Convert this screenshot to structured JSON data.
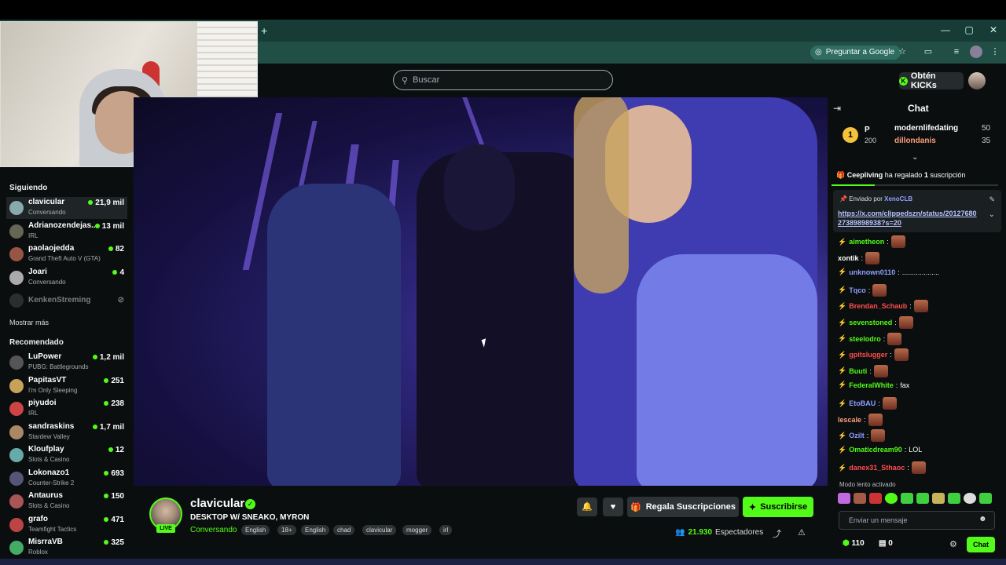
{
  "browser": {
    "new_tab": "+",
    "ask_google": "Preguntar a Google",
    "win_min": "—",
    "win_max": "▢",
    "win_close": "✕"
  },
  "site": {
    "search_placeholder": "Buscar",
    "get_kicks": "Obtén KICKs"
  },
  "sidebar": {
    "following_title": "Siguiendo",
    "following": [
      {
        "name": "clavicular",
        "category": "Conversando",
        "viewers": "21,9 mil"
      },
      {
        "name": "Adrianozendejas...",
        "category": "IRL",
        "viewers": "13 mil"
      },
      {
        "name": "paolaojedda",
        "category": "Grand Theft Auto V (GTA)",
        "viewers": "82"
      },
      {
        "name": "Joari",
        "category": "Conversando",
        "viewers": "4"
      },
      {
        "name": "KenkenStreming",
        "category": "",
        "viewers": ""
      }
    ],
    "show_more": "Mostrar más",
    "recommended_title": "Recomendado",
    "recommended": [
      {
        "name": "LuPower",
        "category": "PUBG: Battlegrounds",
        "viewers": "1,2 mil"
      },
      {
        "name": "PapitasVT",
        "category": "I'm Only Sleeping",
        "viewers": "251"
      },
      {
        "name": "piyudoi",
        "category": "IRL",
        "viewers": "238"
      },
      {
        "name": "sandraskins",
        "category": "Stardew Valley",
        "viewers": "1,7 mil"
      },
      {
        "name": "Kloufplay",
        "category": "Slots & Casino",
        "viewers": "12"
      },
      {
        "name": "Lokonazo1",
        "category": "Counter-Strike 2",
        "viewers": "693"
      },
      {
        "name": "Antaurus",
        "category": "Slots & Casino",
        "viewers": "150"
      },
      {
        "name": "grafo",
        "category": "Teamfight Tactics",
        "viewers": "471"
      },
      {
        "name": "MisrraVB",
        "category": "Roblox",
        "viewers": "325"
      }
    ]
  },
  "stream": {
    "live": "LIVE",
    "name": "clavicular",
    "title": "DESKTOP W/ SNEAKO, MYRON",
    "category": "Conversando",
    "tags": [
      "English",
      "18+",
      "English",
      "chad",
      "clavicular",
      "mogger",
      "irl"
    ],
    "gift_label": "Regala Suscripciones",
    "subscribe_label": "Suscribirse",
    "viewers": "21.930",
    "viewers_label": "Espectadores"
  },
  "chat": {
    "title": "Chat",
    "gifter_rank": "1",
    "gifter_name": "P",
    "gifter_amount": "200",
    "top": [
      {
        "name": "modernlifedating",
        "value": "50"
      },
      {
        "name": "dillondanis",
        "value": "35"
      }
    ],
    "gift_user": "Ceepliving",
    "gift_text": "ha regalado",
    "gift_count": "1",
    "gift_unit": "suscripción",
    "pinned_by_label": "Enviado por",
    "pinned_by_user": "XenoCLB",
    "pinned_link": "https://x.com/clippedszn/status/2012768027389898938?s=20",
    "messages": [
      {
        "user": "aimetheon",
        "text": "",
        "color": "#53fc18"
      },
      {
        "user": "xontik",
        "text": "",
        "color": "#ffffff"
      },
      {
        "user": "unknown0110",
        "text": "...................",
        "color": "#8ea0ff"
      },
      {
        "user": "Tqco",
        "text": "",
        "color": "#8ea0ff"
      },
      {
        "user": "Brendan_Schaub",
        "text": "",
        "color": "#ff4d4d"
      },
      {
        "user": "sevenstoned",
        "text": "",
        "color": "#53fc18"
      },
      {
        "user": "steelodro",
        "text": "",
        "color": "#53fc18"
      },
      {
        "user": "gpitslugger",
        "text": "",
        "color": "#ff4d4d"
      },
      {
        "user": "Buuti",
        "text": "",
        "color": "#53fc18"
      },
      {
        "user": "FederalWhite",
        "text": "fax",
        "color": "#53fc18"
      },
      {
        "user": "EtoBAU",
        "text": "",
        "color": "#8ea0ff"
      },
      {
        "user": "lescale",
        "text": "",
        "color": "#ff9f7a"
      },
      {
        "user": "Ozilt",
        "text": "",
        "color": "#8ea0ff"
      },
      {
        "user": "Omaticdream90",
        "text": "LOL",
        "color": "#53fc18"
      },
      {
        "user": "danex31_Sthaoc",
        "text": "",
        "color": "#ff4d4d"
      }
    ],
    "slow_mode": "Modo lento activado",
    "input_placeholder": "Enviar un mensaje",
    "points": "110",
    "store": "0",
    "chat_button": "Chat"
  },
  "colors": {
    "accent": "#53fc18",
    "background": "#0b0e0f"
  }
}
